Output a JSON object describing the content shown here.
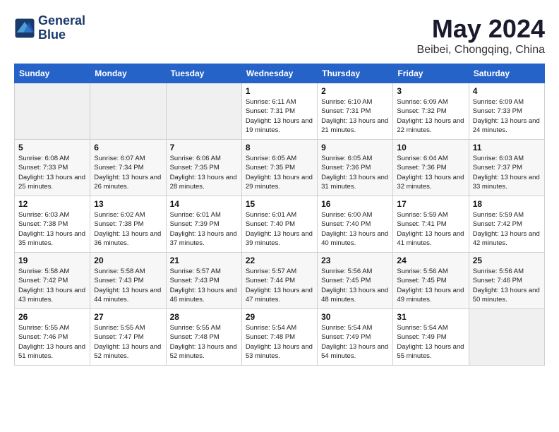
{
  "logo": {
    "line1": "General",
    "line2": "Blue"
  },
  "title": "May 2024",
  "subtitle": "Beibei, Chongqing, China",
  "weekdays": [
    "Sunday",
    "Monday",
    "Tuesday",
    "Wednesday",
    "Thursday",
    "Friday",
    "Saturday"
  ],
  "weeks": [
    [
      {
        "day": "",
        "info": ""
      },
      {
        "day": "",
        "info": ""
      },
      {
        "day": "",
        "info": ""
      },
      {
        "day": "1",
        "info": "Sunrise: 6:11 AM\nSunset: 7:31 PM\nDaylight: 13 hours and 19 minutes."
      },
      {
        "day": "2",
        "info": "Sunrise: 6:10 AM\nSunset: 7:31 PM\nDaylight: 13 hours and 21 minutes."
      },
      {
        "day": "3",
        "info": "Sunrise: 6:09 AM\nSunset: 7:32 PM\nDaylight: 13 hours and 22 minutes."
      },
      {
        "day": "4",
        "info": "Sunrise: 6:09 AM\nSunset: 7:33 PM\nDaylight: 13 hours and 24 minutes."
      }
    ],
    [
      {
        "day": "5",
        "info": "Sunrise: 6:08 AM\nSunset: 7:33 PM\nDaylight: 13 hours and 25 minutes."
      },
      {
        "day": "6",
        "info": "Sunrise: 6:07 AM\nSunset: 7:34 PM\nDaylight: 13 hours and 26 minutes."
      },
      {
        "day": "7",
        "info": "Sunrise: 6:06 AM\nSunset: 7:35 PM\nDaylight: 13 hours and 28 minutes."
      },
      {
        "day": "8",
        "info": "Sunrise: 6:05 AM\nSunset: 7:35 PM\nDaylight: 13 hours and 29 minutes."
      },
      {
        "day": "9",
        "info": "Sunrise: 6:05 AM\nSunset: 7:36 PM\nDaylight: 13 hours and 31 minutes."
      },
      {
        "day": "10",
        "info": "Sunrise: 6:04 AM\nSunset: 7:36 PM\nDaylight: 13 hours and 32 minutes."
      },
      {
        "day": "11",
        "info": "Sunrise: 6:03 AM\nSunset: 7:37 PM\nDaylight: 13 hours and 33 minutes."
      }
    ],
    [
      {
        "day": "12",
        "info": "Sunrise: 6:03 AM\nSunset: 7:38 PM\nDaylight: 13 hours and 35 minutes."
      },
      {
        "day": "13",
        "info": "Sunrise: 6:02 AM\nSunset: 7:38 PM\nDaylight: 13 hours and 36 minutes."
      },
      {
        "day": "14",
        "info": "Sunrise: 6:01 AM\nSunset: 7:39 PM\nDaylight: 13 hours and 37 minutes."
      },
      {
        "day": "15",
        "info": "Sunrise: 6:01 AM\nSunset: 7:40 PM\nDaylight: 13 hours and 39 minutes."
      },
      {
        "day": "16",
        "info": "Sunrise: 6:00 AM\nSunset: 7:40 PM\nDaylight: 13 hours and 40 minutes."
      },
      {
        "day": "17",
        "info": "Sunrise: 5:59 AM\nSunset: 7:41 PM\nDaylight: 13 hours and 41 minutes."
      },
      {
        "day": "18",
        "info": "Sunrise: 5:59 AM\nSunset: 7:42 PM\nDaylight: 13 hours and 42 minutes."
      }
    ],
    [
      {
        "day": "19",
        "info": "Sunrise: 5:58 AM\nSunset: 7:42 PM\nDaylight: 13 hours and 43 minutes."
      },
      {
        "day": "20",
        "info": "Sunrise: 5:58 AM\nSunset: 7:43 PM\nDaylight: 13 hours and 44 minutes."
      },
      {
        "day": "21",
        "info": "Sunrise: 5:57 AM\nSunset: 7:43 PM\nDaylight: 13 hours and 46 minutes."
      },
      {
        "day": "22",
        "info": "Sunrise: 5:57 AM\nSunset: 7:44 PM\nDaylight: 13 hours and 47 minutes."
      },
      {
        "day": "23",
        "info": "Sunrise: 5:56 AM\nSunset: 7:45 PM\nDaylight: 13 hours and 48 minutes."
      },
      {
        "day": "24",
        "info": "Sunrise: 5:56 AM\nSunset: 7:45 PM\nDaylight: 13 hours and 49 minutes."
      },
      {
        "day": "25",
        "info": "Sunrise: 5:56 AM\nSunset: 7:46 PM\nDaylight: 13 hours and 50 minutes."
      }
    ],
    [
      {
        "day": "26",
        "info": "Sunrise: 5:55 AM\nSunset: 7:46 PM\nDaylight: 13 hours and 51 minutes."
      },
      {
        "day": "27",
        "info": "Sunrise: 5:55 AM\nSunset: 7:47 PM\nDaylight: 13 hours and 52 minutes."
      },
      {
        "day": "28",
        "info": "Sunrise: 5:55 AM\nSunset: 7:48 PM\nDaylight: 13 hours and 52 minutes."
      },
      {
        "day": "29",
        "info": "Sunrise: 5:54 AM\nSunset: 7:48 PM\nDaylight: 13 hours and 53 minutes."
      },
      {
        "day": "30",
        "info": "Sunrise: 5:54 AM\nSunset: 7:49 PM\nDaylight: 13 hours and 54 minutes."
      },
      {
        "day": "31",
        "info": "Sunrise: 5:54 AM\nSunset: 7:49 PM\nDaylight: 13 hours and 55 minutes."
      },
      {
        "day": "",
        "info": ""
      }
    ]
  ]
}
